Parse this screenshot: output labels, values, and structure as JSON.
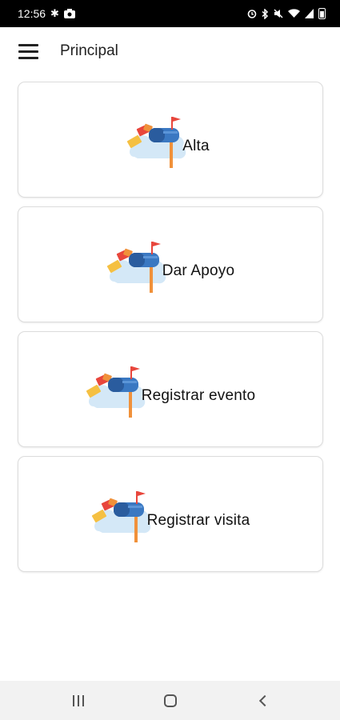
{
  "status_bar": {
    "time": "12:56",
    "left_icons": [
      "asterisk-icon",
      "camera-icon"
    ],
    "right_icons": [
      "alarm-icon",
      "bluetooth-icon",
      "mute-icon",
      "wifi-icon",
      "signal-icon",
      "battery-icon"
    ]
  },
  "app_bar": {
    "title": "Principal",
    "menu_icon": "hamburger-menu-icon"
  },
  "cards": [
    {
      "label": "Alta",
      "icon": "mailbox-icon"
    },
    {
      "label": "Dar Apoyo",
      "icon": "mailbox-icon"
    },
    {
      "label": "Registrar evento",
      "icon": "mailbox-icon"
    },
    {
      "label": "Registrar visita",
      "icon": "mailbox-icon"
    }
  ],
  "colors": {
    "mailbox_blue": "#3a78c2",
    "mailbox_dark_blue": "#2a5c9e",
    "post_orange": "#f0913a",
    "flag_red": "#e8463c",
    "letter_yellow": "#f5c042",
    "cloud_blue": "#d4e8f7"
  },
  "nav_bar": {
    "icons": [
      "recents-icon",
      "home-icon",
      "back-icon"
    ]
  }
}
